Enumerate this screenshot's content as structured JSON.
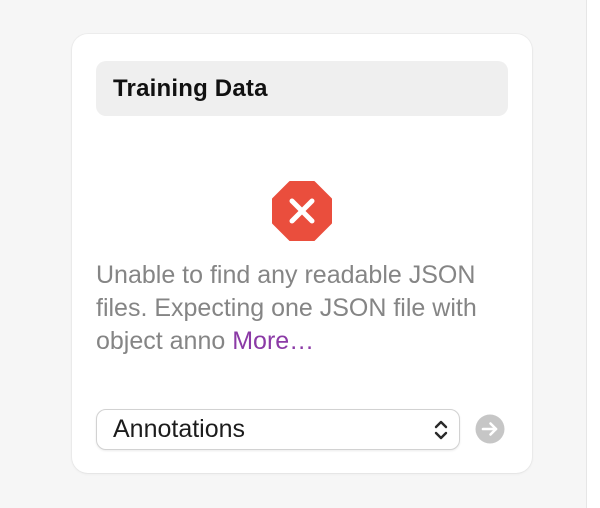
{
  "panel": {
    "title": "Training Data"
  },
  "status": {
    "icon": "error-stop-icon",
    "message": "Unable to find any readable JSON files. Expecting one JSON file with object anno ",
    "more_link": "More…"
  },
  "annotations_popup": {
    "selected": "Annotations",
    "icon": "chevron-up-down-icon"
  },
  "go_button": {
    "icon": "arrow-right-circle-icon"
  },
  "colors": {
    "error": "#ea4e3d",
    "link": "#8b3aa6",
    "message_text": "#858585",
    "title_field_bg": "#efefef",
    "go_button_disabled": "#c6c6c6"
  }
}
